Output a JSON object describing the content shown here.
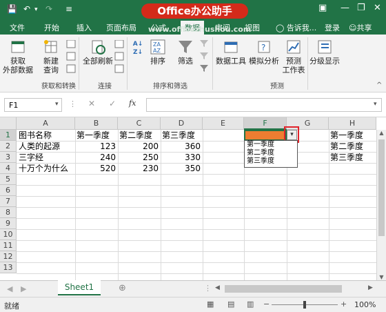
{
  "title_logo": "Office办公助手",
  "watermark": "www.officezhushou.com",
  "tabs": [
    "文件",
    "开始",
    "插入",
    "页面布局",
    "公式",
    "数据",
    "审阅",
    "视图"
  ],
  "tell_me": "告诉我...",
  "login": "登录",
  "share": "共享",
  "ribbon": {
    "get_external": "获取\n外部数据",
    "new_query": "新建\n查询",
    "refresh_all": "全部刷新",
    "sort": "排序",
    "filter": "筛选",
    "data_tools": "数据工具",
    "what_if": "模拟分析",
    "forecast_sheet": "预测\n工作表",
    "outline": "分级显示",
    "group_get_transform": "获取和转换",
    "group_connections": "连接",
    "group_sort_filter": "排序和筛选",
    "group_forecast": "预测"
  },
  "namebox": "F1",
  "columns": [
    "A",
    "B",
    "C",
    "D",
    "E",
    "F",
    "G",
    "H"
  ],
  "rows": [
    "1",
    "2",
    "3",
    "4",
    "5",
    "6",
    "7",
    "8",
    "9",
    "10",
    "11",
    "12",
    "13"
  ],
  "cells": {
    "A1": "图书名称",
    "B1": "第一季度",
    "C1": "第二季度",
    "D1": "第三季度",
    "A2": "人类的起源",
    "B2": "123",
    "C2": "200",
    "D2": "360",
    "A3": "三字经",
    "B3": "240",
    "C3": "250",
    "D3": "330",
    "A4": "十万个为什么",
    "B4": "520",
    "C4": "230",
    "D4": "350",
    "H1": "第一季度",
    "H2": "第二季度",
    "H3": "第三季度"
  },
  "dropdown_items": [
    "第一季度",
    "第二季度",
    "第三季度"
  ],
  "sheet_tab": "Sheet1",
  "status": "就绪",
  "zoom": "100%",
  "colors": {
    "excel_green": "#217346",
    "selected_fill": "#ed7d31",
    "highlight_red": "#e0222a"
  }
}
